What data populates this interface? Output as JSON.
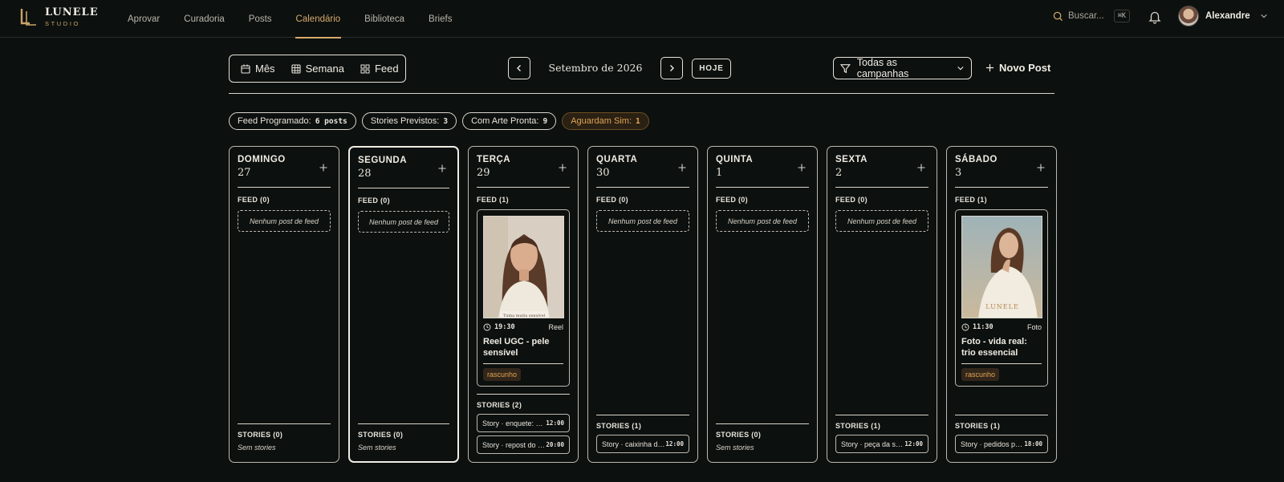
{
  "brand": {
    "name": "LUNELE",
    "sub": "STUDIO"
  },
  "nav": [
    "Aprovar",
    "Curadoria",
    "Posts",
    "Calendário",
    "Biblioteca",
    "Briefs"
  ],
  "search": {
    "placeholder": "Buscar...",
    "shortcut": "⌘K"
  },
  "user": {
    "name": "Alexandre"
  },
  "views": [
    "Mês",
    "Semana",
    "Feed"
  ],
  "period_label": "Setembro de 2026",
  "today_label": "HOJE",
  "campaign_filter": "Todas as campanhas",
  "new_post_label": "Novo Post",
  "stats": [
    {
      "label": "Feed Programado:",
      "value": "6 posts"
    },
    {
      "label": "Stories Previstos:",
      "value": "3"
    },
    {
      "label": "Com Arte Pronta:",
      "value": "9"
    },
    {
      "label": "Aguardam Sim:",
      "value": "1"
    }
  ],
  "colors": {
    "accent": "#d8ab6e",
    "warn": "#e2a554",
    "background": "#0c100e"
  },
  "days": [
    {
      "name": "DOMINGO",
      "num": "27",
      "feed_label": "FEED (0)",
      "empty_feed": "Nenhum post de feed",
      "stories_label": "STORIES (0)",
      "no_stories": "Sem stories"
    },
    {
      "name": "SEGUNDA",
      "num": "28",
      "feed_label": "FEED (0)",
      "empty_feed": "Nenhum post de feed",
      "stories_label": "STORIES (0)",
      "no_stories": "Sem stories"
    },
    {
      "name": "TERÇA",
      "num": "29",
      "feed_label": "FEED (1)",
      "post": {
        "time": "19:30",
        "type": "Reel",
        "title": "Reel UGC - pele sensível",
        "status": "rascunho",
        "caption": "Tinha muita sensível"
      },
      "stories_label": "STORIES (2)",
      "stories": [
        {
          "text": "Story · enquete: pele",
          "time": "12:00"
        },
        {
          "text": "Story · repost do Reel",
          "time": "20:00"
        }
      ]
    },
    {
      "name": "QUARTA",
      "num": "30",
      "feed_label": "FEED (0)",
      "empty_feed": "Nenhum post de feed",
      "stories_label": "STORIES (1)",
      "stories": [
        {
          "text": "Story · caixinha de perguntas",
          "time": "12:00"
        }
      ]
    },
    {
      "name": "QUINTA",
      "num": "1",
      "feed_label": "FEED (0)",
      "empty_feed": "Nenhum post de feed",
      "stories_label": "STORIES (0)",
      "no_stories": "Sem stories"
    },
    {
      "name": "SEXTA",
      "num": "2",
      "feed_label": "FEED (0)",
      "empty_feed": "Nenhum post de feed",
      "stories_label": "STORIES (1)",
      "stories": [
        {
          "text": "Story · peça da semana",
          "time": "12:00"
        }
      ]
    },
    {
      "name": "SÁBADO",
      "num": "3",
      "feed_label": "FEED (1)",
      "post": {
        "time": "11:30",
        "type": "Foto",
        "title": "Foto - vida real: trio essencial",
        "status": "rascunho",
        "caption": "LUNELE"
      },
      "stories_label": "STORIES (1)",
      "stories": [
        {
          "text": "Story · pedidos pelo direct",
          "time": "18:00"
        }
      ]
    }
  ]
}
